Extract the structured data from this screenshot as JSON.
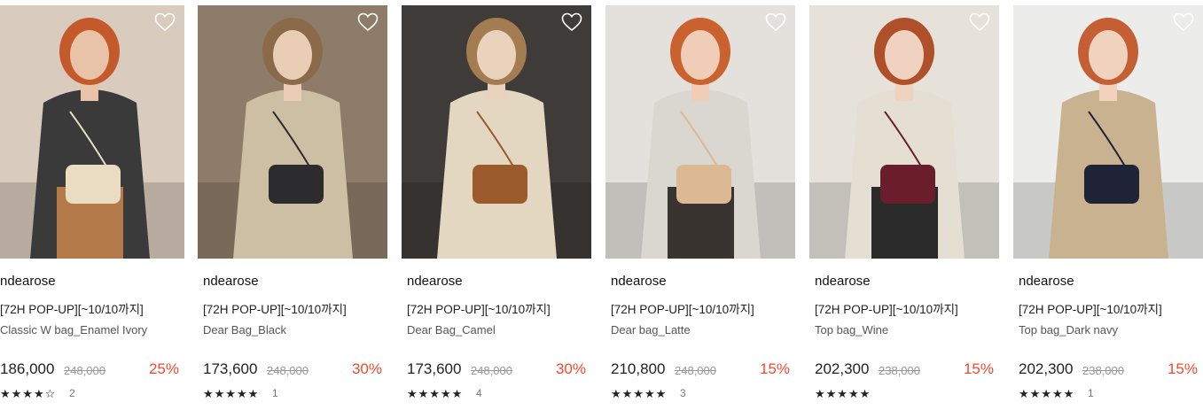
{
  "products": [
    {
      "brand": "ndearose",
      "promo": "[72H POP-UP][~10/10까지]",
      "name": "Classic W bag_Enamel Ivory",
      "price": "186,000",
      "original_price": "248,000",
      "discount": "25%",
      "rating": 4.5,
      "stars": "★★★★☆",
      "review_count": "2",
      "image_icon": "model-with-ivory-bag",
      "palette": {
        "bg": "#d9cbbd",
        "coat": "#3a3a3a",
        "skin": "#e8c3a8",
        "hair": "#c45a2c",
        "bag": "#e9dcc2",
        "skirt": "#b47a49"
      }
    },
    {
      "brand": "ndearose",
      "promo": "[72H POP-UP][~10/10까지]",
      "name": "Dear Bag_Black",
      "price": "173,600",
      "original_price": "248,000",
      "discount": "30%",
      "rating": 5,
      "stars": "★★★★★",
      "review_count": "1",
      "image_icon": "model-with-black-bag",
      "palette": {
        "bg": "#8d7c69",
        "coat": "#cdbfa4",
        "skin": "#e9cdb5",
        "hair": "#8b6a4a",
        "bag": "#2c2c2e",
        "skirt": "#cdbfa4"
      }
    },
    {
      "brand": "ndearose",
      "promo": "[72H POP-UP][~10/10까지]",
      "name": "Dear Bag_Camel",
      "price": "173,600",
      "original_price": "248,000",
      "discount": "30%",
      "rating": 5,
      "stars": "★★★★★",
      "review_count": "4",
      "image_icon": "model-with-camel-bag",
      "palette": {
        "bg": "#3f3b38",
        "coat": "#e3d7c1",
        "skin": "#ead3bd",
        "hair": "#a37c52",
        "bag": "#9a5a2c",
        "skirt": "#e3d7c1"
      }
    },
    {
      "brand": "ndearose",
      "promo": "[72H POP-UP][~10/10까지]",
      "name": "Dear bag_Latte",
      "price": "210,800",
      "original_price": "248,000",
      "discount": "15%",
      "rating": 5,
      "stars": "★★★★★",
      "review_count": "3",
      "image_icon": "model-with-latte-bag",
      "palette": {
        "bg": "#e4e1dc",
        "coat": "#d9d7cf",
        "skin": "#f0cdb6",
        "hair": "#c9622e",
        "bag": "#dcb992",
        "skirt": "#3a3431"
      }
    },
    {
      "brand": "ndearose",
      "promo": "[72H POP-UP][~10/10까지]",
      "name": "Top bag_Wine",
      "price": "202,300",
      "original_price": "238,000",
      "discount": "15%",
      "rating": 5,
      "stars": "★★★★★",
      "review_count": "",
      "image_icon": "model-with-wine-bag",
      "palette": {
        "bg": "#e6e2da",
        "coat": "#e4ded3",
        "skin": "#efd2bf",
        "hair": "#b0502a",
        "bag": "#6a1e2c",
        "skirt": "#2a2a2a"
      }
    },
    {
      "brand": "ndearose",
      "promo": "[72H POP-UP][~10/10까지]",
      "name": "Top bag_Dark navy",
      "price": "202,300",
      "original_price": "238,000",
      "discount": "15%",
      "rating": 5,
      "stars": "★★★★★",
      "review_count": "1",
      "image_icon": "model-with-navy-bag",
      "palette": {
        "bg": "#ececea",
        "coat": "#c9b28f",
        "skin": "#f0d2bf",
        "hair": "#c35f32",
        "bag": "#1f2336",
        "skirt": "#c9b28f"
      }
    }
  ]
}
